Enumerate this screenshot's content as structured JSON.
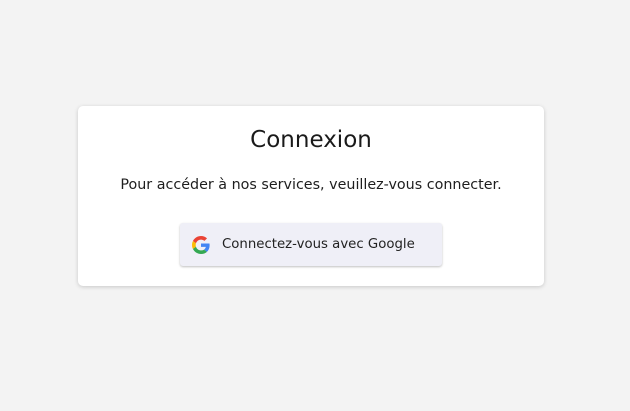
{
  "login": {
    "title": "Connexion",
    "message": "Pour accéder à nos services, veuillez-vous connecter.",
    "google_button": {
      "label": "Connectez-vous avec Google",
      "icon": "google-g-icon"
    }
  },
  "colors": {
    "page_background": "#f3f3f3",
    "card_background": "#ffffff",
    "button_background": "#efeff7",
    "google_blue": "#4285F4",
    "google_red": "#EA4335",
    "google_yellow": "#FBBC05",
    "google_green": "#34A853"
  }
}
